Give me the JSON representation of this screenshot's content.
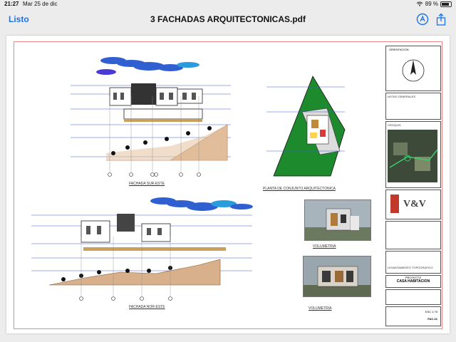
{
  "status": {
    "time": "21:27",
    "date": "Mar 25 de dic",
    "battery": "89 %"
  },
  "nav": {
    "done": "Listo",
    "title": "3 FACHADAS ARQUITECTONICAS.pdf"
  },
  "drawing": {
    "labels": {
      "fachada_sur_este": "FACHADA SUR-ESTE",
      "fachada_nor_este": "FACHADA NOR-ESTE",
      "planta": "PLANTA DE CONJUNTO ARQUITECTONICA",
      "volumetria1": "VOLUMETRIA",
      "volumetria2": "VOLUMETRIA"
    },
    "titleblock": {
      "orientacion": "ORIENTACION",
      "notas": "NOTAS GENERALES",
      "croquis": "CROQUIS",
      "logo": "V&V",
      "proyecto_label": "PROYECTO",
      "proyecto": "CASA HABITACION",
      "levantamiento": "LEVANTAMIENTO TOPOGRAFICO",
      "escala": "ESC 1:75",
      "plano": "FAC-01"
    }
  },
  "colors": {
    "accent": "#1a73e8",
    "grass": "#1e8a2e",
    "terrain": "#d9b08c",
    "frame": "#e88888"
  }
}
